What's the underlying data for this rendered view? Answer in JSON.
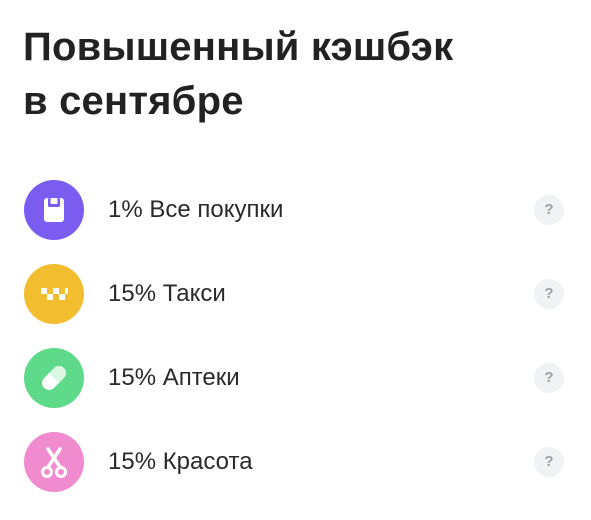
{
  "title": {
    "line1": "Повышенный кэшбэк",
    "line2": "в сентябре"
  },
  "categories": [
    {
      "label": "1% Все покупки",
      "icon": "shopping-bag-icon",
      "color": "#7b5cf0"
    },
    {
      "label": "15% Такси",
      "icon": "taxi-checker-icon",
      "color": "#f2bd2e"
    },
    {
      "label": "15% Аптеки",
      "icon": "pill-icon",
      "color": "#5fd98a"
    },
    {
      "label": "15% Красота",
      "icon": "scissors-icon",
      "color": "#f08bd0"
    }
  ],
  "help_symbol": "?"
}
